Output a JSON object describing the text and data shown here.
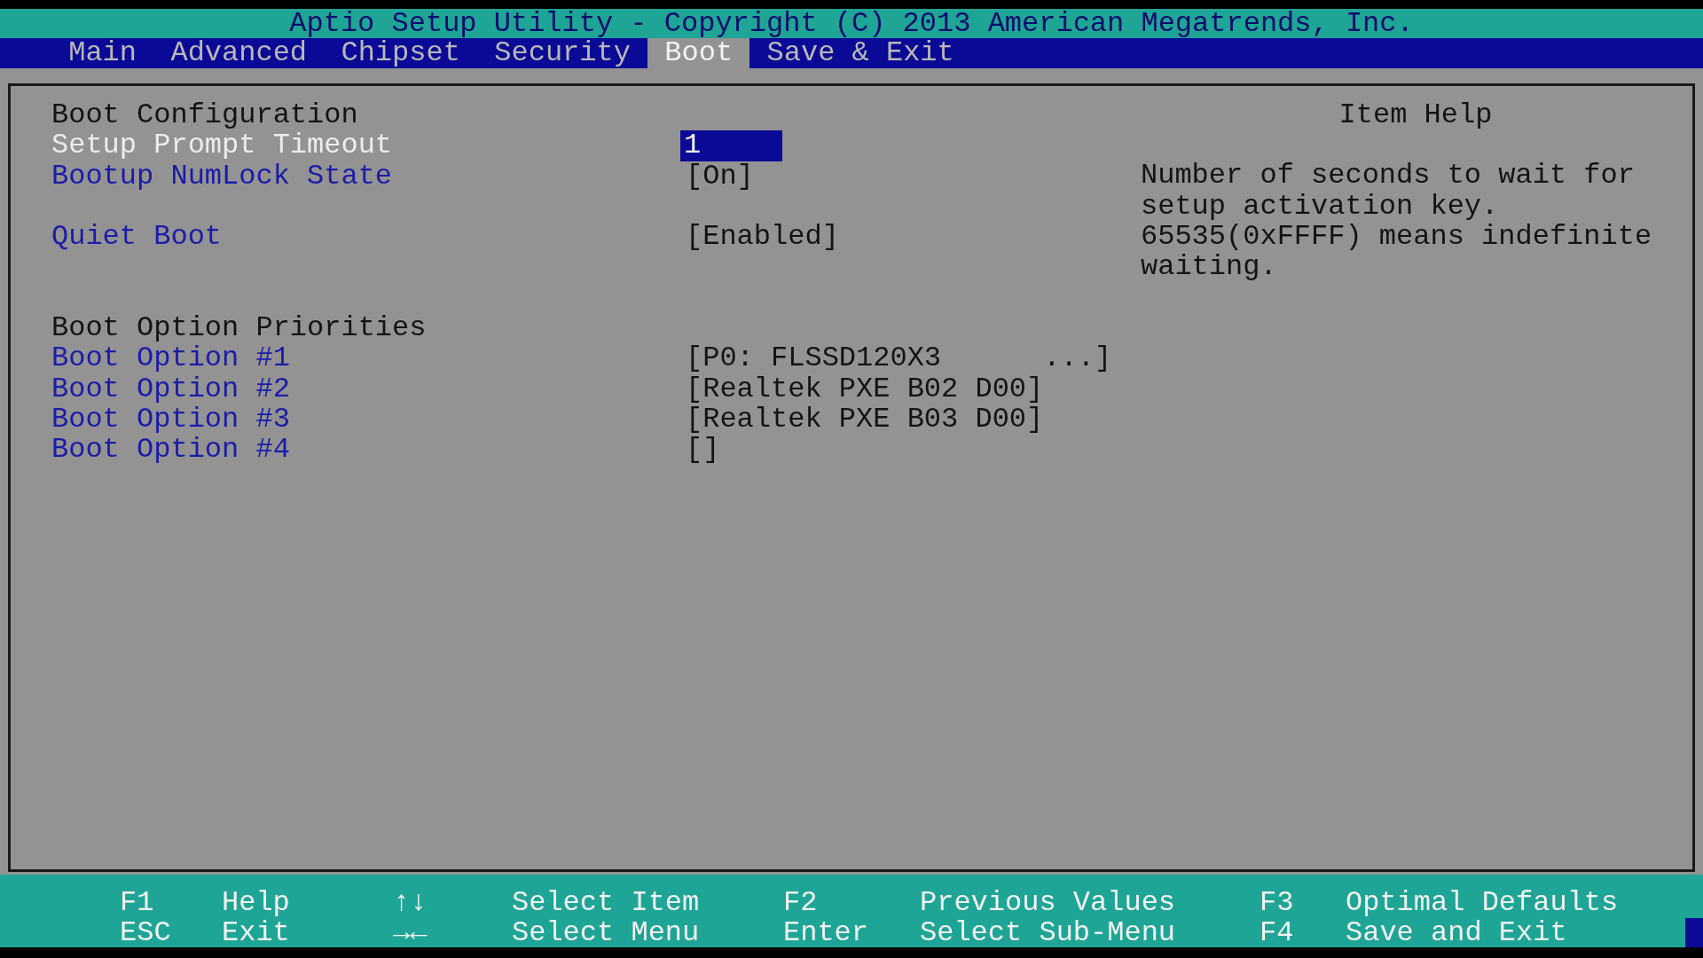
{
  "title": "Aptio Setup Utility - Copyright (C) 2013 American Megatrends, Inc.",
  "tabs": [
    {
      "label": "Main",
      "selected": false
    },
    {
      "label": "Advanced",
      "selected": false
    },
    {
      "label": "Chipset",
      "selected": false
    },
    {
      "label": "Security",
      "selected": false
    },
    {
      "label": "Boot",
      "selected": true
    },
    {
      "label": "Save & Exit",
      "selected": false
    }
  ],
  "rows": [
    {
      "kind": "heading",
      "label": "Boot Configuration"
    },
    {
      "kind": "setting",
      "label": "Setup Prompt Timeout",
      "value": "1",
      "selected": true
    },
    {
      "kind": "setting",
      "label": "Bootup NumLock State",
      "value": "[On]",
      "selected": false
    },
    {
      "kind": "spacer"
    },
    {
      "kind": "setting",
      "label": "Quiet Boot",
      "value": "[Enabled]",
      "selected": false
    },
    {
      "kind": "spacer"
    },
    {
      "kind": "spacer"
    },
    {
      "kind": "heading",
      "label": "Boot Option Priorities"
    },
    {
      "kind": "setting",
      "label": "Boot Option #1",
      "value": "[P0: FLSSD120X3      ...]",
      "selected": false
    },
    {
      "kind": "setting",
      "label": "Boot Option #2",
      "value": "[Realtek PXE B02 D00]",
      "selected": false
    },
    {
      "kind": "setting",
      "label": "Boot Option #3",
      "value": "[Realtek PXE B03 D00]",
      "selected": false
    },
    {
      "kind": "setting",
      "label": "Boot Option #4",
      "value": "[]",
      "selected": false
    }
  ],
  "help": {
    "title": "Item Help",
    "text": "Number of seconds to wait for setup activation key. 65535(0xFFFF) means indefinite waiting."
  },
  "keys": [
    [
      {
        "key": "F1",
        "action": "Help"
      },
      {
        "key": "↑↓",
        "action": "Select Item"
      },
      {
        "key": "F2",
        "action": "Previous Values"
      },
      {
        "key": "F3",
        "action": "Optimal Defaults"
      }
    ],
    [
      {
        "key": "ESC",
        "action": "Exit"
      },
      {
        "key": "→←",
        "action": "Select Menu"
      },
      {
        "key": "Enter",
        "action": "Select Sub-Menu"
      },
      {
        "key": "F4",
        "action": "Save and Exit"
      }
    ]
  ]
}
